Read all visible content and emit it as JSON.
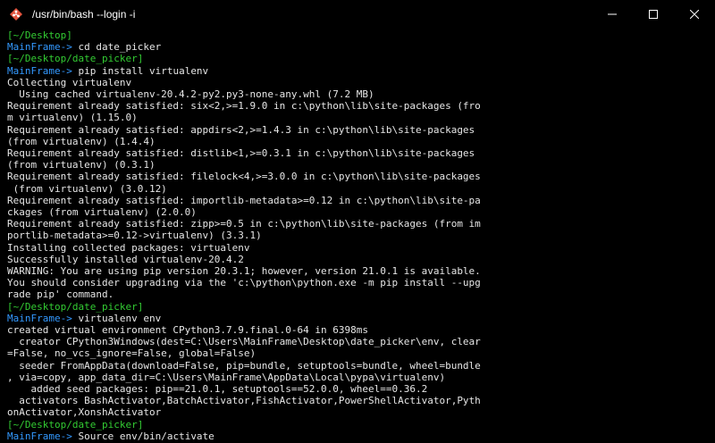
{
  "window": {
    "title": "/usr/bin/bash --login -i",
    "controls": [
      "minimize",
      "maximize",
      "close"
    ]
  },
  "terminal": {
    "lines": [
      {
        "segments": [
          {
            "text": "[~/Desktop]",
            "c": "green"
          }
        ]
      },
      {
        "segments": [
          {
            "text": "MainFrame-> ",
            "c": "blue"
          },
          {
            "text": "cd date_picker",
            "c": "white"
          }
        ]
      },
      {
        "segments": [
          {
            "text": "[~/Desktop/date_picker]",
            "c": "green"
          }
        ]
      },
      {
        "segments": [
          {
            "text": "MainFrame-> ",
            "c": "blue"
          },
          {
            "text": "pip install virtualenv",
            "c": "white"
          }
        ]
      },
      {
        "segments": [
          {
            "text": "Collecting virtualenv",
            "c": "white"
          }
        ]
      },
      {
        "segments": [
          {
            "text": "  Using cached virtualenv-20.4.2-py2.py3-none-any.whl (7.2 MB)",
            "c": "white"
          }
        ]
      },
      {
        "segments": [
          {
            "text": "Requirement already satisfied: six<2,>=1.9.0 in c:\\python\\lib\\site-packages (fro",
            "c": "white"
          }
        ]
      },
      {
        "segments": [
          {
            "text": "m virtualenv) (1.15.0)",
            "c": "white"
          }
        ]
      },
      {
        "segments": [
          {
            "text": "Requirement already satisfied: appdirs<2,>=1.4.3 in c:\\python\\lib\\site-packages",
            "c": "white"
          }
        ]
      },
      {
        "segments": [
          {
            "text": "(from virtualenv) (1.4.4)",
            "c": "white"
          }
        ]
      },
      {
        "segments": [
          {
            "text": "Requirement already satisfied: distlib<1,>=0.3.1 in c:\\python\\lib\\site-packages",
            "c": "white"
          }
        ]
      },
      {
        "segments": [
          {
            "text": "(from virtualenv) (0.3.1)",
            "c": "white"
          }
        ]
      },
      {
        "segments": [
          {
            "text": "Requirement already satisfied: filelock<4,>=3.0.0 in c:\\python\\lib\\site-packages",
            "c": "white"
          }
        ]
      },
      {
        "segments": [
          {
            "text": " (from virtualenv) (3.0.12)",
            "c": "white"
          }
        ]
      },
      {
        "segments": [
          {
            "text": "Requirement already satisfied: importlib-metadata>=0.12 in c:\\python\\lib\\site-pa",
            "c": "white"
          }
        ]
      },
      {
        "segments": [
          {
            "text": "ckages (from virtualenv) (2.0.0)",
            "c": "white"
          }
        ]
      },
      {
        "segments": [
          {
            "text": "Requirement already satisfied: zipp>=0.5 in c:\\python\\lib\\site-packages (from im",
            "c": "white"
          }
        ]
      },
      {
        "segments": [
          {
            "text": "portlib-metadata>=0.12->virtualenv) (3.3.1)",
            "c": "white"
          }
        ]
      },
      {
        "segments": [
          {
            "text": "Installing collected packages: virtualenv",
            "c": "white"
          }
        ]
      },
      {
        "segments": [
          {
            "text": "Successfully installed virtualenv-20.4.2",
            "c": "white"
          }
        ]
      },
      {
        "segments": [
          {
            "text": "WARNING: You are using pip version 20.3.1; however, version 21.0.1 is available.",
            "c": "white"
          }
        ]
      },
      {
        "segments": [
          {
            "text": "You should consider upgrading via the 'c:\\python\\python.exe -m pip install --upg",
            "c": "white"
          }
        ]
      },
      {
        "segments": [
          {
            "text": "rade pip' command.",
            "c": "white"
          }
        ]
      },
      {
        "segments": [
          {
            "text": "[~/Desktop/date_picker]",
            "c": "green"
          }
        ]
      },
      {
        "segments": [
          {
            "text": "MainFrame-> ",
            "c": "blue"
          },
          {
            "text": "virtualenv env",
            "c": "white"
          }
        ]
      },
      {
        "segments": [
          {
            "text": "created virtual environment CPython3.7.9.final.0-64 in 6398ms",
            "c": "white"
          }
        ]
      },
      {
        "segments": [
          {
            "text": "  creator CPython3Windows(dest=C:\\Users\\MainFrame\\Desktop\\date_picker\\env, clear",
            "c": "white"
          }
        ]
      },
      {
        "segments": [
          {
            "text": "=False, no_vcs_ignore=False, global=False)",
            "c": "white"
          }
        ]
      },
      {
        "segments": [
          {
            "text": "  seeder FromAppData(download=False, pip=bundle, setuptools=bundle, wheel=bundle",
            "c": "white"
          }
        ]
      },
      {
        "segments": [
          {
            "text": ", via=copy, app_data_dir=C:\\Users\\MainFrame\\AppData\\Local\\pypa\\virtualenv)",
            "c": "white"
          }
        ]
      },
      {
        "segments": [
          {
            "text": "    added seed packages: pip==21.0.1, setuptools==52.0.0, wheel==0.36.2",
            "c": "white"
          }
        ]
      },
      {
        "segments": [
          {
            "text": "  activators BashActivator,BatchActivator,FishActivator,PowerShellActivator,Pyth",
            "c": "white"
          }
        ]
      },
      {
        "segments": [
          {
            "text": "onActivator,XonshActivator",
            "c": "white"
          }
        ]
      },
      {
        "segments": [
          {
            "text": "[~/Desktop/date_picker]",
            "c": "green"
          }
        ]
      },
      {
        "segments": [
          {
            "text": "MainFrame-> ",
            "c": "blue"
          },
          {
            "text": "Source env/bin/activate",
            "c": "white"
          }
        ]
      }
    ]
  }
}
